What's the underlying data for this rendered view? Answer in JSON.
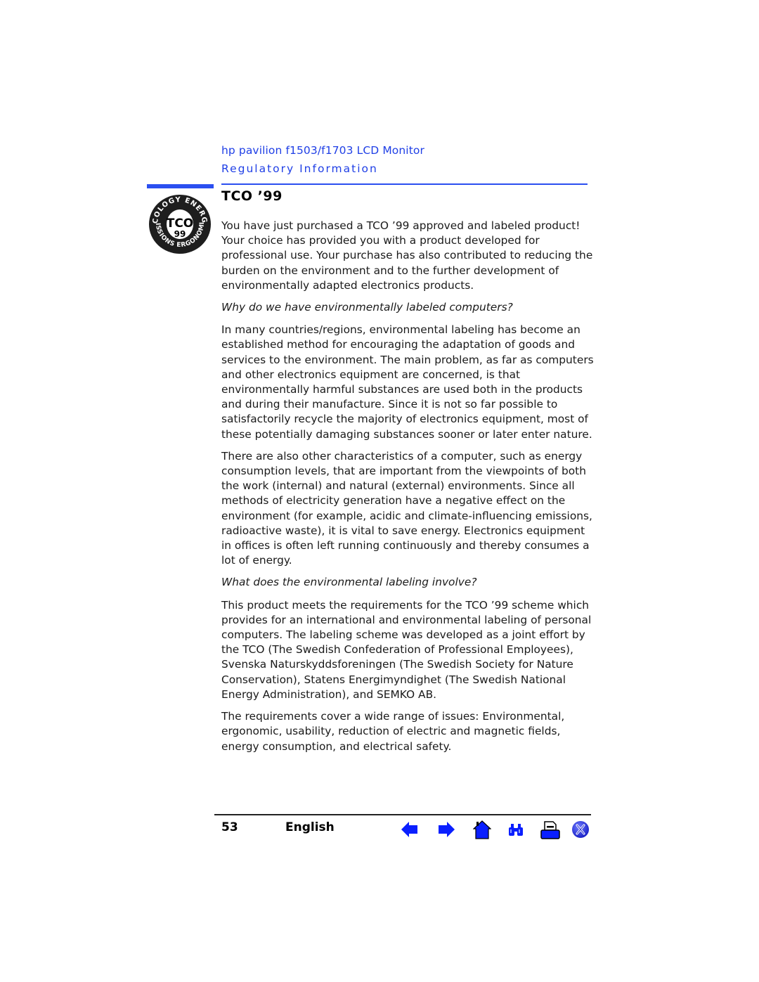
{
  "header": {
    "product": "hp pavilion f1503/f1703 LCD Monitor",
    "section": "Regulatory Information"
  },
  "title": "TCO ’99",
  "logo": {
    "icon": "tco99-logo-icon",
    "top_text": "ECOLOGY ENERGY",
    "bottom_text": "EMISSIONS ERGONOMICS",
    "center_text": "TCO",
    "number": "99"
  },
  "body": {
    "p1": "You have just purchased a TCO ’99 approved and labeled product! Your choice has provided you with a product developed for professional use. Your purchase has also contributed to reducing the burden on the environment and to the further development of environmentally adapted electronics products.",
    "q1": "Why do we have environmentally labeled computers?",
    "p2": "In many countries/regions, environmental labeling has become an established method for encouraging the adaptation of goods and services to the environment. The main problem, as far as computers and other electronics equipment are concerned, is that environmentally harmful substances are used both in the products and during their manufacture. Since it is not so far possible to satisfactorily recycle the majority of electronics equipment, most of these potentially damaging substances sooner or later enter nature.",
    "p3": "There are also other characteristics of a computer, such as energy consumption levels, that are important from the viewpoints of both the work (internal) and natural (external) environments. Since all methods of electricity generation have a negative effect on the environment (for example, acidic and climate-influencing emissions, radioactive waste), it is vital to save energy. Electronics equipment in offices is often left running continuously and thereby consumes a lot of energy.",
    "q2": "What does the environmental labeling involve?",
    "p4": "This product meets the requirements for the TCO ’99 scheme which provides for an international and environmental labeling of personal computers. The labeling scheme was developed as a joint effort by the TCO (The Swedish Confederation of Professional Employees), Svenska Naturskyddsforeningen (The Swedish Society for Nature Conservation), Statens Energimyndighet (The Swedish National Energy Administration), and SEMKO AB.",
    "p5": "The requirements cover a wide range of issues: Environmental, ergonomic, usability, reduction of electric and magnetic fields, energy consumption, and electrical safety."
  },
  "footer": {
    "page_number": "53",
    "language": "English",
    "nav_icons": [
      "arrow-left-icon",
      "arrow-right-icon",
      "home-icon",
      "binoculars-icon",
      "printer-icon",
      "close-icon"
    ]
  },
  "colors": {
    "accent": "#2b4ff0",
    "header_text": "#1f3fe6",
    "nav_blue": "#0a1fff"
  }
}
